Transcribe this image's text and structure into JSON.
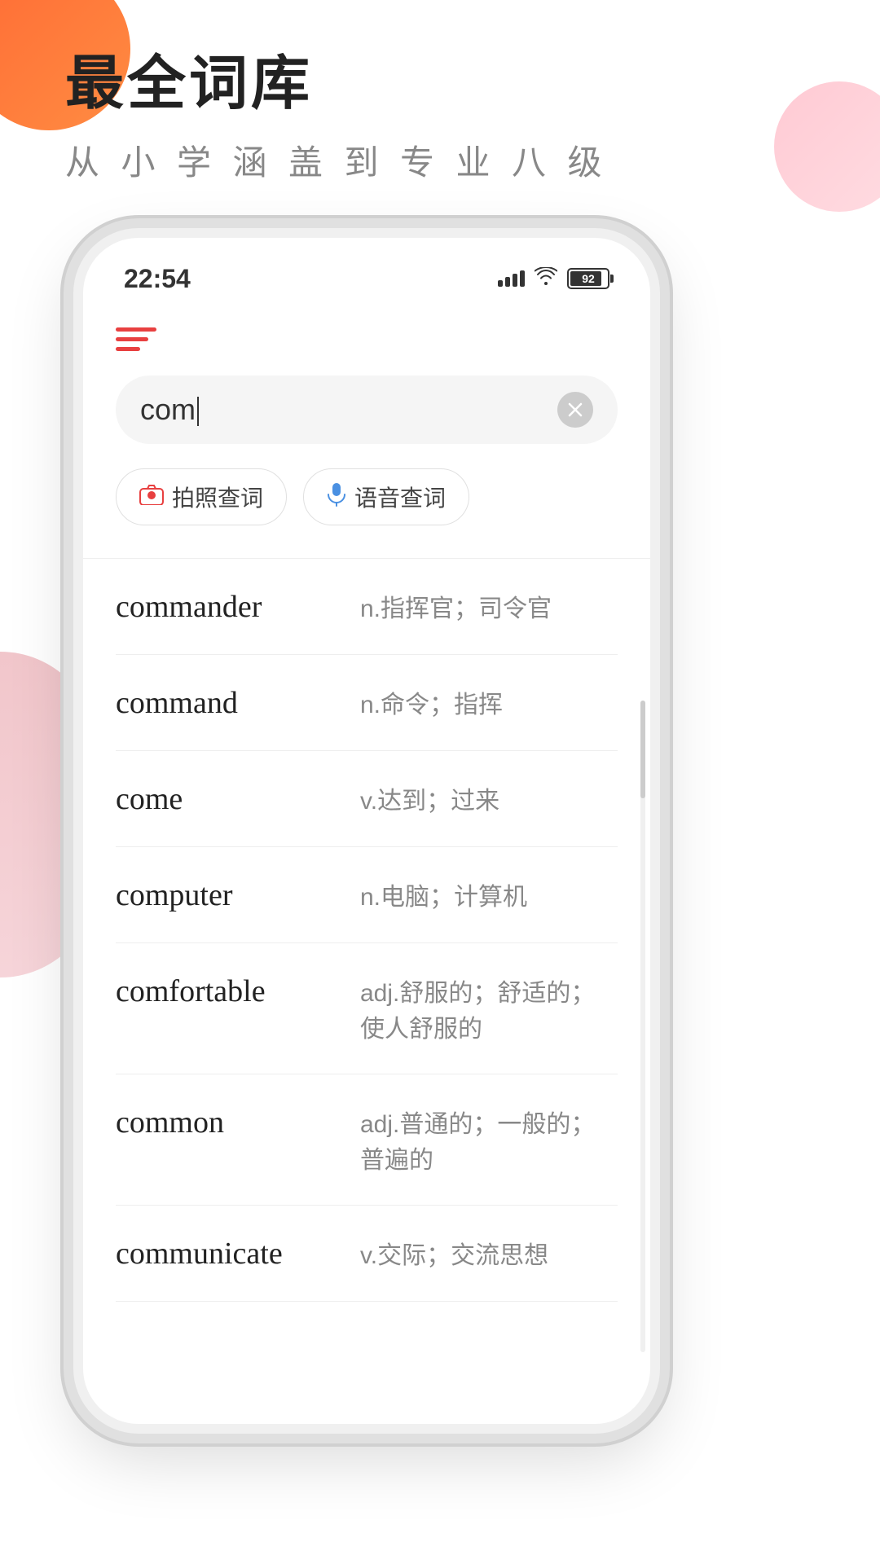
{
  "background": {
    "circle_orange": "orange-decorative-circle",
    "circle_pink": "pink-decorative-circle",
    "wave_left": "left-wave-decoration"
  },
  "header": {
    "main_title": "最全词库",
    "sub_title": "从 小 学 涵 盖 到 专 业 八 级"
  },
  "status_bar": {
    "time": "22:54",
    "battery_percent": "92"
  },
  "search": {
    "input_value": "com",
    "placeholder": "com"
  },
  "action_buttons": {
    "photo_search": "拍照查词",
    "voice_search": "语音查词"
  },
  "word_list": [
    {
      "english": "commander",
      "chinese": "n.指挥官；司令官"
    },
    {
      "english": "command",
      "chinese": "n.命令；指挥"
    },
    {
      "english": "come",
      "chinese": "v.达到；过来"
    },
    {
      "english": "computer",
      "chinese": "n.电脑；计算机"
    },
    {
      "english": "comfortable",
      "chinese": "adj.舒服的；舒适的；使人舒服的"
    },
    {
      "english": "common",
      "chinese": "adj.普通的；一般的；普遍的"
    },
    {
      "english": "communicate",
      "chinese": "v.交际；交流思想"
    }
  ]
}
